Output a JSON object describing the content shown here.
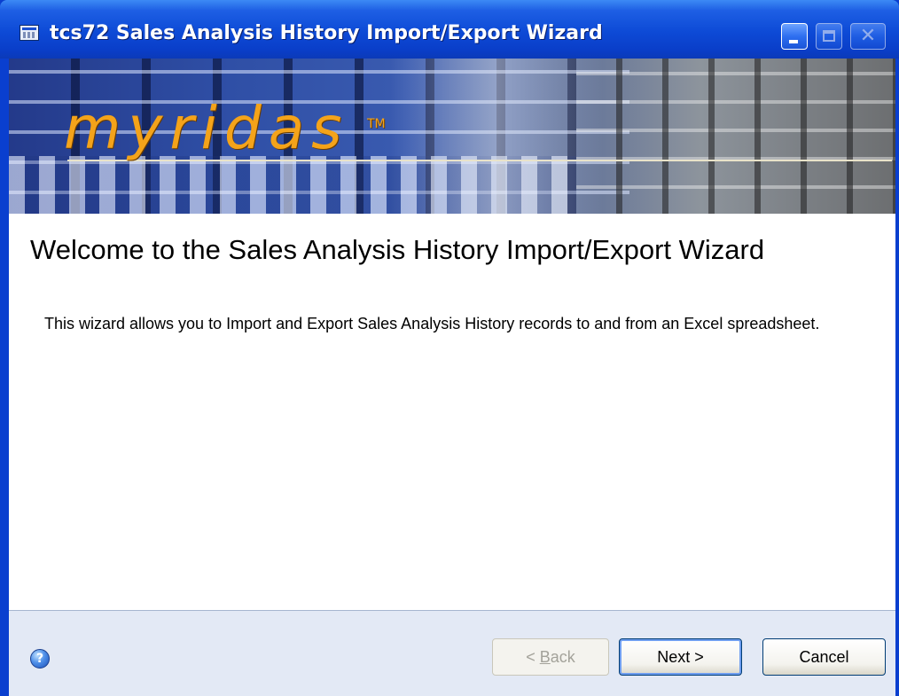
{
  "window": {
    "title": "tcs72 Sales Analysis History Import/Export Wizard",
    "controls": {
      "minimize_icon": "minimize-icon",
      "maximize_icon": "maximize-icon",
      "close_icon": "close-icon",
      "close_glyph": "✕"
    }
  },
  "banner": {
    "logo_text": "myridas",
    "trademark": "TM"
  },
  "page": {
    "title": "Welcome to the Sales Analysis History Import/Export Wizard",
    "description": "This wizard allows you to Import and Export Sales Analysis History records to and from an Excel spreadsheet."
  },
  "footer": {
    "help_glyph": "?",
    "back_prefix": "< ",
    "back_underlined": "B",
    "back_rest": "ack",
    "next_label": "Next >",
    "cancel_label": "Cancel"
  },
  "colors": {
    "titlebar": "#0a3fcf",
    "logo": "#f4a31a",
    "footer_bg": "#e3e9f5"
  }
}
